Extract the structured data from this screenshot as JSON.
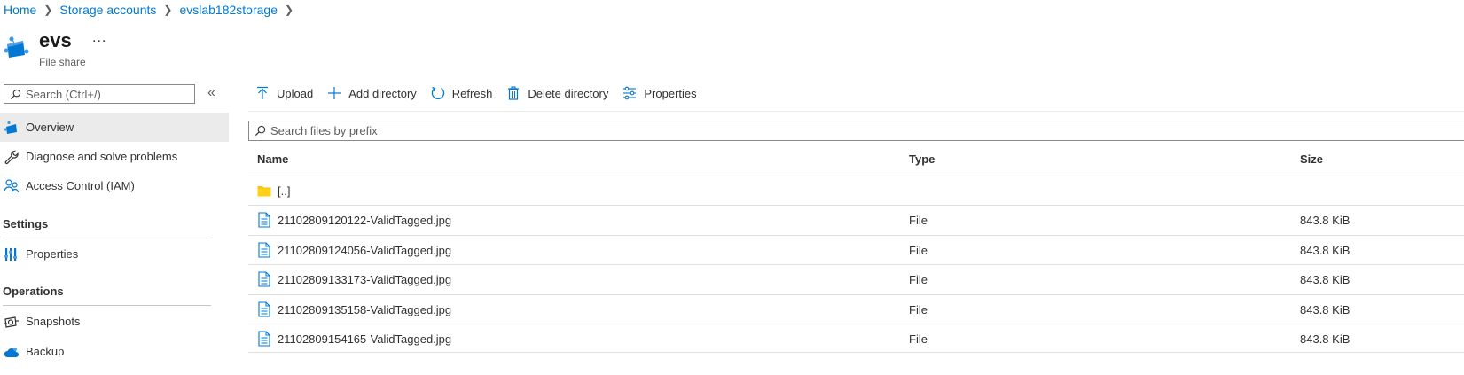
{
  "breadcrumb": [
    {
      "label": "Home"
    },
    {
      "label": "Storage accounts"
    },
    {
      "label": "evslab182storage"
    }
  ],
  "header": {
    "title": "evs",
    "more_label": "...",
    "subtitle": "File share"
  },
  "sidebar": {
    "search_placeholder": "Search (Ctrl+/)",
    "collapse_label": "«",
    "items": [
      {
        "label": "Overview",
        "icon": "file-share-icon"
      },
      {
        "label": "Diagnose and solve problems",
        "icon": "wrench-icon"
      },
      {
        "label": "Access Control (IAM)",
        "icon": "people-icon"
      }
    ],
    "sections": [
      {
        "title": "Settings",
        "items": [
          {
            "label": "Properties",
            "icon": "properties-bars-icon"
          }
        ]
      },
      {
        "title": "Operations",
        "items": [
          {
            "label": "Snapshots",
            "icon": "snapshot-icon"
          },
          {
            "label": "Backup",
            "icon": "backup-cloud-icon"
          }
        ]
      }
    ]
  },
  "toolbar": {
    "upload": "Upload",
    "add_directory": "Add directory",
    "refresh": "Refresh",
    "delete_directory": "Delete directory",
    "properties": "Properties"
  },
  "filter": {
    "placeholder": "Search files by prefix"
  },
  "table": {
    "columns": [
      "Name",
      "Type",
      "Size"
    ],
    "parent_row": {
      "name": "[..]"
    },
    "rows": [
      {
        "name": "21102809120122-ValidTagged.jpg",
        "type": "File",
        "size": "843.8 KiB"
      },
      {
        "name": "21102809124056-ValidTagged.jpg",
        "type": "File",
        "size": "843.8 KiB"
      },
      {
        "name": "21102809133173-ValidTagged.jpg",
        "type": "File",
        "size": "843.8 KiB"
      },
      {
        "name": "21102809135158-ValidTagged.jpg",
        "type": "File",
        "size": "843.8 KiB"
      },
      {
        "name": "21102809154165-ValidTagged.jpg",
        "type": "File",
        "size": "843.8 KiB"
      }
    ]
  },
  "colors": {
    "link": "#0078d4",
    "folder": "#f4c21a",
    "icon_blue": "#0078d4",
    "nav_active_bg": "#ebebeb"
  }
}
